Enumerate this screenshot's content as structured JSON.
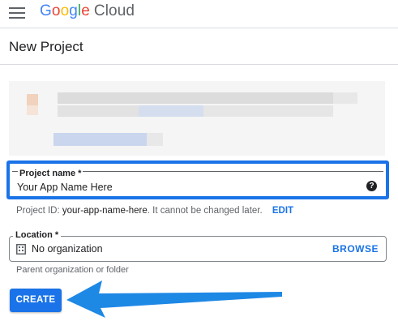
{
  "header": {
    "logo_letters": [
      "G",
      "o",
      "o",
      "g",
      "l",
      "e"
    ],
    "logo_suffix": "Cloud"
  },
  "page": {
    "title": "New Project"
  },
  "project_name": {
    "label": "Project name *",
    "value": "Your App Name Here",
    "help_icon": "help-circle-icon"
  },
  "project_id": {
    "prefix": "Project ID: ",
    "value": "your-app-name-here",
    "suffix": ". It cannot be changed later.",
    "edit_label": "EDIT"
  },
  "location": {
    "label": "Location *",
    "value": "No organization",
    "icon": "building-icon",
    "browse_label": "BROWSE",
    "helper": "Parent organization or folder"
  },
  "actions": {
    "create_label": "CREATE"
  },
  "colors": {
    "accent": "#1a73e8",
    "arrow": "#1e88e5"
  }
}
